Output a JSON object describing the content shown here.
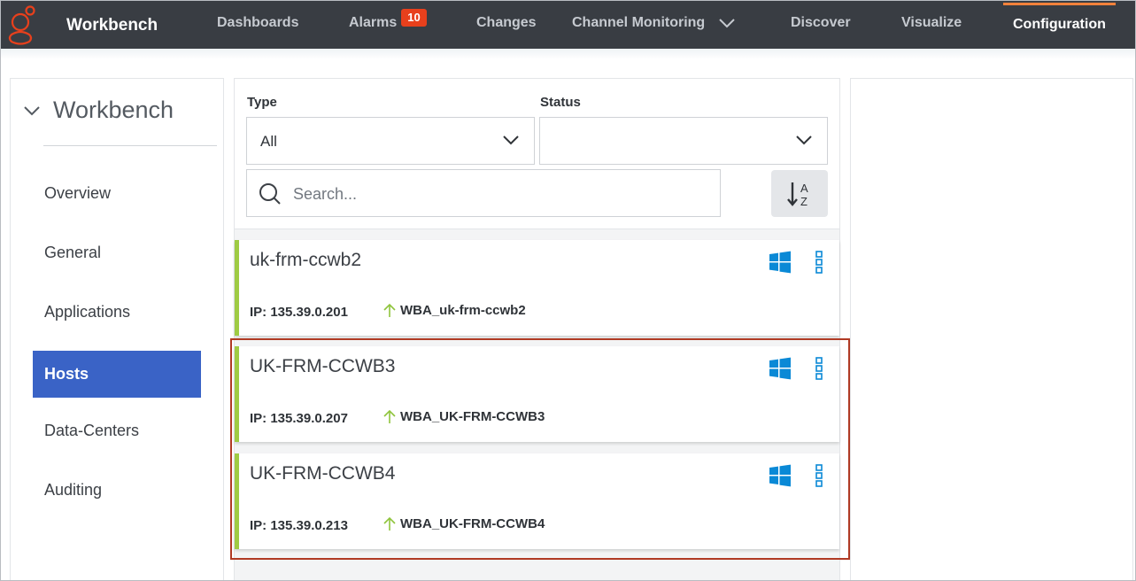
{
  "topbar": {
    "app_title": "Workbench",
    "nav": [
      {
        "label": "Dashboards"
      },
      {
        "label": "Alarms",
        "badge": "10"
      },
      {
        "label": "Changes"
      },
      {
        "label": "Channel Monitoring"
      },
      {
        "label": "Discover"
      },
      {
        "label": "Visualize"
      },
      {
        "label": "Configuration",
        "active": true
      }
    ]
  },
  "sidebar": {
    "title": "Workbench",
    "items": [
      {
        "label": "Overview"
      },
      {
        "label": "General"
      },
      {
        "label": "Applications"
      },
      {
        "label": "Hosts",
        "active": true
      },
      {
        "label": "Data-Centers"
      },
      {
        "label": "Auditing"
      }
    ]
  },
  "filters": {
    "type_label": "Type",
    "type_value": "All",
    "status_label": "Status",
    "status_value": "",
    "search_placeholder": "Search...",
    "sort_icon": "sort-alpha-asc-icon"
  },
  "hosts": [
    {
      "name": "uk-frm-ccwb2",
      "ip": "IP: 135.39.0.201",
      "app": "WBA_uk-frm-ccwb2",
      "os_icon": "windows-icon",
      "status_color": "#9fcb44"
    },
    {
      "name": "UK-FRM-CCWB3",
      "ip": "IP: 135.39.0.207",
      "app": "WBA_UK-FRM-CCWB3",
      "os_icon": "windows-icon",
      "status_color": "#9fcb44"
    },
    {
      "name": "UK-FRM-CCWB4",
      "ip": "IP: 135.39.0.213",
      "app": "WBA_UK-FRM-CCWB4",
      "os_icon": "windows-icon",
      "status_color": "#9fcb44"
    }
  ],
  "colors": {
    "topbar_bg": "#393d43",
    "accent_active_tab": "#f2823b",
    "badge": "#e8401c",
    "sidebar_active": "#3a63c6",
    "status_up": "#9fcb44",
    "windows_blue": "#0a89d6",
    "highlight_box": "#b03a24"
  }
}
